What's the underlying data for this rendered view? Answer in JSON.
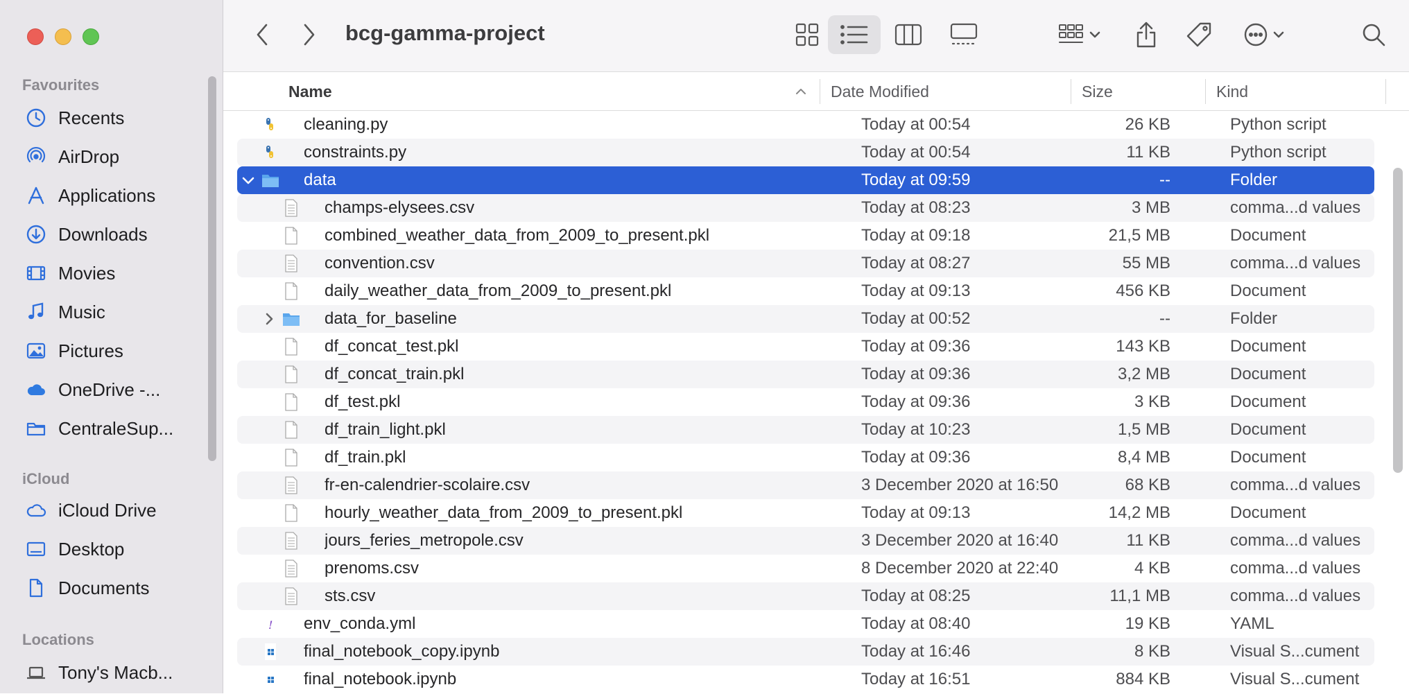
{
  "window": {
    "title": "bcg-gamma-project"
  },
  "sidebar": {
    "favourites_heading": "Favourites",
    "favourites": [
      {
        "label": "Recents",
        "icon": "clock-icon"
      },
      {
        "label": "AirDrop",
        "icon": "airdrop-icon"
      },
      {
        "label": "Applications",
        "icon": "applications-icon"
      },
      {
        "label": "Downloads",
        "icon": "downloads-icon"
      },
      {
        "label": "Movies",
        "icon": "movies-icon"
      },
      {
        "label": "Music",
        "icon": "music-icon"
      },
      {
        "label": "Pictures",
        "icon": "pictures-icon"
      },
      {
        "label": "OneDrive -...",
        "icon": "cloud-icon"
      },
      {
        "label": "CentraleSup...",
        "icon": "folder-icon"
      }
    ],
    "icloud_heading": "iCloud",
    "icloud": [
      {
        "label": "iCloud Drive",
        "icon": "icloud-icon"
      },
      {
        "label": "Desktop",
        "icon": "desktop-icon"
      },
      {
        "label": "Documents",
        "icon": "document-icon"
      }
    ],
    "locations_heading": "Locations",
    "locations": [
      {
        "label": "Tony's Macb...",
        "icon": "laptop-icon"
      }
    ]
  },
  "columns": {
    "name": "Name",
    "date": "Date Modified",
    "size": "Size",
    "kind": "Kind"
  },
  "accent_color": "#2c5fd5",
  "rows": [
    {
      "name": "cleaning.py",
      "date": "Today at 00:54",
      "size": "26 KB",
      "kind": "Python script",
      "icon": "python-icon",
      "level": 0
    },
    {
      "name": "constraints.py",
      "date": "Today at 00:54",
      "size": "11 KB",
      "kind": "Python script",
      "icon": "python-icon",
      "level": 0
    },
    {
      "name": "data",
      "date": "Today at 09:59",
      "size": "--",
      "kind": "Folder",
      "icon": "folder-icon",
      "level": 0,
      "expanded": true,
      "selected": true
    },
    {
      "name": "champs-elysees.csv",
      "date": "Today at 08:23",
      "size": "3 MB",
      "kind": "comma...d values",
      "icon": "csv-icon",
      "level": 1
    },
    {
      "name": "combined_weather_data_from_2009_to_present.pkl",
      "date": "Today at 09:18",
      "size": "21,5 MB",
      "kind": "Document",
      "icon": "document-icon",
      "level": 1
    },
    {
      "name": "convention.csv",
      "date": "Today at 08:27",
      "size": "55 MB",
      "kind": "comma...d values",
      "icon": "csv-icon",
      "level": 1
    },
    {
      "name": "daily_weather_data_from_2009_to_present.pkl",
      "date": "Today at 09:13",
      "size": "456 KB",
      "kind": "Document",
      "icon": "document-icon",
      "level": 1
    },
    {
      "name": "data_for_baseline",
      "date": "Today at 00:52",
      "size": "--",
      "kind": "Folder",
      "icon": "folder-icon",
      "level": 1,
      "expanded": false
    },
    {
      "name": "df_concat_test.pkl",
      "date": "Today at 09:36",
      "size": "143 KB",
      "kind": "Document",
      "icon": "document-icon",
      "level": 1
    },
    {
      "name": "df_concat_train.pkl",
      "date": "Today at 09:36",
      "size": "3,2 MB",
      "kind": "Document",
      "icon": "document-icon",
      "level": 1
    },
    {
      "name": "df_test.pkl",
      "date": "Today at 09:36",
      "size": "3 KB",
      "kind": "Document",
      "icon": "document-icon",
      "level": 1
    },
    {
      "name": "df_train_light.pkl",
      "date": "Today at 10:23",
      "size": "1,5 MB",
      "kind": "Document",
      "icon": "document-icon",
      "level": 1
    },
    {
      "name": "df_train.pkl",
      "date": "Today at 09:36",
      "size": "8,4 MB",
      "kind": "Document",
      "icon": "document-icon",
      "level": 1
    },
    {
      "name": "fr-en-calendrier-scolaire.csv",
      "date": "3 December 2020 at 16:50",
      "size": "68 KB",
      "kind": "comma...d values",
      "icon": "csv-icon",
      "level": 1
    },
    {
      "name": "hourly_weather_data_from_2009_to_present.pkl",
      "date": "Today at 09:13",
      "size": "14,2 MB",
      "kind": "Document",
      "icon": "document-icon",
      "level": 1
    },
    {
      "name": "jours_feries_metropole.csv",
      "date": "3 December 2020 at 16:40",
      "size": "11 KB",
      "kind": "comma...d values",
      "icon": "csv-icon",
      "level": 1
    },
    {
      "name": "prenoms.csv",
      "date": "8 December 2020 at 22:40",
      "size": "4 KB",
      "kind": "comma...d values",
      "icon": "csv-icon",
      "level": 1
    },
    {
      "name": "sts.csv",
      "date": "Today at 08:25",
      "size": "11,1 MB",
      "kind": "comma...d values",
      "icon": "csv-icon",
      "level": 1
    },
    {
      "name": "env_conda.yml",
      "date": "Today at 08:40",
      "size": "19 KB",
      "kind": "YAML",
      "icon": "yaml-icon",
      "level": 0
    },
    {
      "name": "final_notebook_copy.ipynb",
      "date": "Today at 16:46",
      "size": "8 KB",
      "kind": "Visual S...cument",
      "icon": "notebook-icon",
      "level": 0
    },
    {
      "name": "final_notebook.ipynb",
      "date": "Today at 16:51",
      "size": "884 KB",
      "kind": "Visual S...cument",
      "icon": "notebook-icon",
      "level": 0
    }
  ]
}
